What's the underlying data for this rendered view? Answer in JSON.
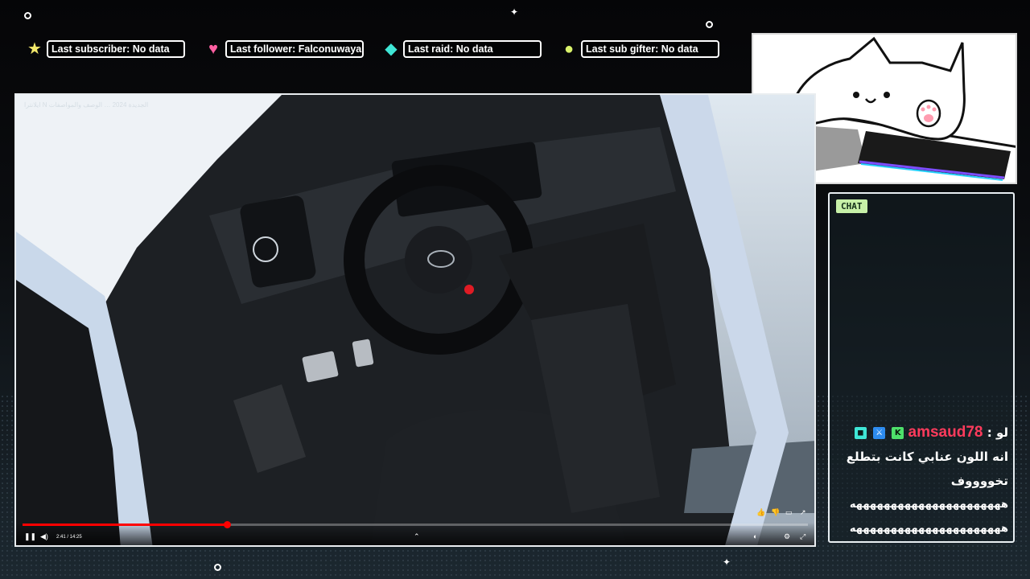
{
  "stats": {
    "subscriber": "Last subscriber: No data",
    "follower": "Last follower: Falconuwaya",
    "raid": "Last raid: No data",
    "gifter": "Last sub gifter: No data"
  },
  "icons": {
    "subscriber": "star-icon",
    "follower": "heart-icon",
    "raid": "diamond-icon",
    "gifter": "gift-icon"
  },
  "player": {
    "title": "ايلانترا N الجديدة 2024 … الوصف والمواصفات",
    "time": "2:41 / 14:25",
    "progress": 0.26
  },
  "chat": {
    "label": "CHAT",
    "message": {
      "username": "amsaud78",
      "separator": ":",
      "line1": "لو",
      "line2": "انه اللون عنابي كانت بتطلع",
      "line3": "تخووووف",
      "line4": "ههههههههههههههههههههههه",
      "line5": "ههههههههههههههههههههههه"
    }
  },
  "colors": {
    "accent_red": "#ff0000",
    "username": "#ff3b5c",
    "chat_tag": "#c7f0a8",
    "star": "#f3e96b",
    "heart": "#ff5fa2",
    "diamond": "#3fe6d6",
    "gift": "#d9f26b"
  }
}
